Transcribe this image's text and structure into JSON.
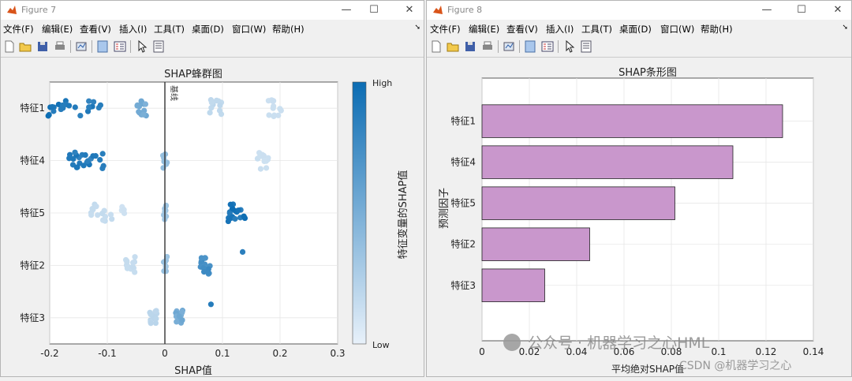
{
  "fig7": {
    "title": "Figure 7",
    "menu": [
      "文件(F)",
      "编辑(E)",
      "查看(V)",
      "插入(I)",
      "工具(T)",
      "桌面(D)",
      "窗口(W)",
      "帮助(H)"
    ],
    "toolbar_icons": [
      "new-file-icon",
      "open-folder-icon",
      "save-icon",
      "print-icon",
      "link-plot-icon",
      "dock-icon",
      "legend-icon",
      "pointer-icon",
      "property-inspector-icon"
    ]
  },
  "fig8": {
    "title": "Figure 8",
    "menu": [
      "文件(F)",
      "编辑(E)",
      "查看(V)",
      "插入(I)",
      "工具(T)",
      "桌面(D)",
      "窗口(W)",
      "帮助(H)"
    ],
    "toolbar_icons": [
      "new-file-icon",
      "open-folder-icon",
      "save-icon",
      "print-icon",
      "link-plot-icon",
      "dock-icon",
      "legend-icon",
      "pointer-icon",
      "property-inspector-icon"
    ]
  },
  "chart_data": [
    {
      "type": "scatter",
      "title": "SHAP蜂群图",
      "xlabel": "SHAP值",
      "colorbar_label": "特征变量的SHAP值",
      "colorbar_high": "High",
      "colorbar_low": "Low",
      "baseline_label": "基线",
      "xlim": [
        -0.2,
        0.3
      ],
      "xticks": [
        "-0.2",
        "-0.1",
        "0",
        "0.1",
        "0.2",
        "0.3"
      ],
      "xtick_values": [
        -0.2,
        -0.1,
        0,
        0.1,
        0.2,
        0.3
      ],
      "categories": [
        "特征1",
        "特征4",
        "特征5",
        "特征2",
        "特征3"
      ],
      "grid": true,
      "colors": {
        "high": "#0b6cb3",
        "low": "#e3eef8"
      },
      "series": [
        {
          "category": "特征1",
          "clusters": [
            {
              "x": -0.18,
              "spread": 0.025,
              "n": 14,
              "c": 1.0
            },
            {
              "x": -0.13,
              "spread": 0.02,
              "n": 9,
              "c": 0.95
            },
            {
              "x": -0.04,
              "spread": 0.008,
              "n": 14,
              "c": 0.55
            },
            {
              "x": 0.09,
              "spread": 0.012,
              "n": 12,
              "c": 0.18
            },
            {
              "x": 0.19,
              "spread": 0.012,
              "n": 12,
              "c": 0.12
            }
          ]
        },
        {
          "category": "特征4",
          "clusters": [
            {
              "x": -0.15,
              "spread": 0.018,
              "n": 16,
              "c": 0.98
            },
            {
              "x": -0.12,
              "spread": 0.015,
              "n": 9,
              "c": 0.95
            },
            {
              "x": 0.0,
              "spread": 0.004,
              "n": 8,
              "c": 0.4
            },
            {
              "x": 0.17,
              "spread": 0.012,
              "n": 14,
              "c": 0.12
            }
          ]
        },
        {
          "category": "特征5",
          "clusters": [
            {
              "x": -0.11,
              "spread": 0.018,
              "n": 14,
              "c": 0.15
            },
            {
              "x": -0.07,
              "spread": 0.006,
              "n": 5,
              "c": 0.1
            },
            {
              "x": 0.0,
              "spread": 0.004,
              "n": 8,
              "c": 0.35
            },
            {
              "x": 0.125,
              "spread": 0.015,
              "n": 18,
              "c": 1.0
            }
          ]
        },
        {
          "category": "特征2",
          "clusters": [
            {
              "x": -0.06,
              "spread": 0.008,
              "n": 14,
              "c": 0.15
            },
            {
              "x": 0.0,
              "spread": 0.004,
              "n": 8,
              "c": 0.35
            },
            {
              "x": 0.07,
              "spread": 0.01,
              "n": 18,
              "c": 0.8
            },
            {
              "x": 0.135,
              "spread": 0.0,
              "n": 1,
              "c": 1.0
            }
          ]
        },
        {
          "category": "特征3",
          "clusters": [
            {
              "x": -0.02,
              "spread": 0.006,
              "n": 12,
              "c": 0.2
            },
            {
              "x": 0.025,
              "spread": 0.006,
              "n": 14,
              "c": 0.55
            },
            {
              "x": 0.08,
              "spread": 0.0,
              "n": 1,
              "c": 1.0
            }
          ]
        }
      ]
    },
    {
      "type": "bar",
      "orientation": "horizontal",
      "title": "SHAP条形图",
      "xlabel": "平均绝对SHAP值",
      "ylabel": "预测因子",
      "categories": [
        "特征1",
        "特征4",
        "特征5",
        "特征2",
        "特征3"
      ],
      "values": [
        0.127,
        0.106,
        0.0815,
        0.0455,
        0.0265
      ],
      "xlim": [
        0,
        0.14
      ],
      "xticks": [
        "0",
        "0.02",
        "0.04",
        "0.06",
        "0.08",
        "0.1",
        "0.12",
        "0.14"
      ],
      "xtick_values": [
        0,
        0.02,
        0.04,
        0.06,
        0.08,
        0.1,
        0.12,
        0.14
      ],
      "bar_color": "#c997cc",
      "grid": true
    }
  ],
  "watermark": {
    "line1": "公众号 · 机器学习之心HML",
    "line2": "CSDN @机器学习之心"
  }
}
